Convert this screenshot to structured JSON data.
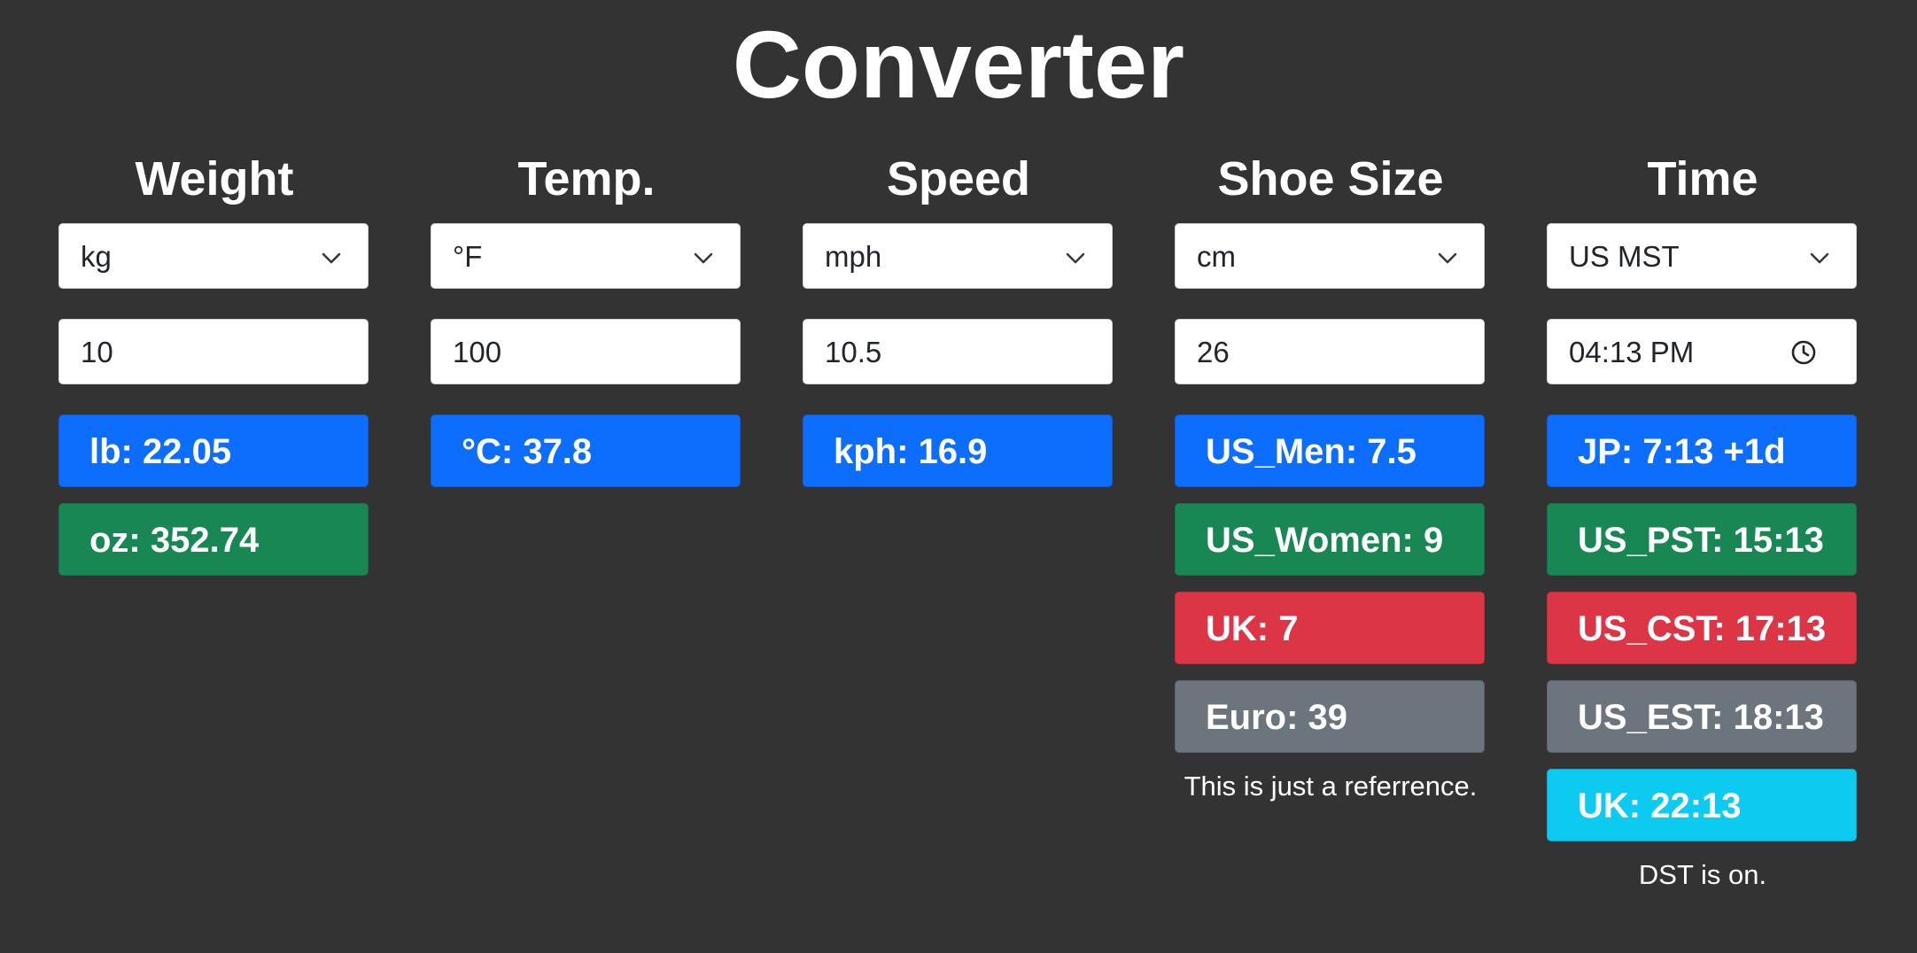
{
  "title": "Converter",
  "colors": {
    "background": "#333333",
    "primary": "#0d6efd",
    "success": "#198754",
    "danger": "#dc3545",
    "secondary": "#6c757d",
    "info": "#0dcaf0"
  },
  "columns": {
    "weight": {
      "heading": "Weight",
      "unit": "kg",
      "value": "10",
      "results": [
        "lb: 22.05",
        "oz: 352.74"
      ]
    },
    "temp": {
      "heading": "Temp.",
      "unit": "°F",
      "value": "100",
      "results": [
        "°C: 37.8"
      ]
    },
    "speed": {
      "heading": "Speed",
      "unit": "mph",
      "value": "10.5",
      "results": [
        "kph: 16.9"
      ]
    },
    "shoe": {
      "heading": "Shoe Size",
      "unit": "cm",
      "value": "26",
      "results": [
        "US_Men: 7.5",
        "US_Women: 9",
        "UK: 7",
        "Euro: 39"
      ],
      "note": "This is just a referrence."
    },
    "time": {
      "heading": "Time",
      "unit": "US MST",
      "value": "04:13 PM",
      "results": [
        "JP: 7:13 +1d",
        "US_PST: 15:13",
        "US_CST: 17:13",
        "US_EST: 18:13",
        "UK: 22:13"
      ],
      "note": "DST is on.",
      "icons": [
        "chevron-down-icon",
        "clock-icon"
      ]
    }
  }
}
